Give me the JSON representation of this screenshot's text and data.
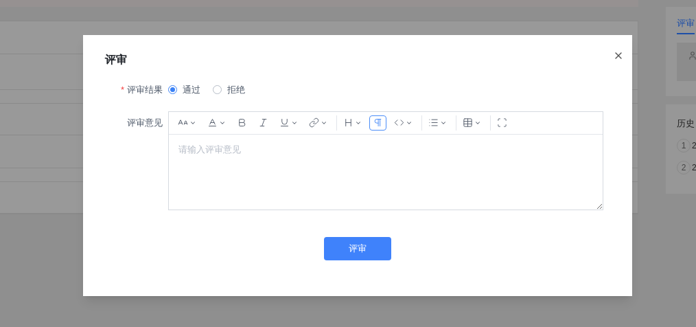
{
  "background": {
    "tabs": [
      {
        "label": "评审",
        "selected": true
      }
    ],
    "history": {
      "title": "历史",
      "steps": [
        {
          "index": "1",
          "text": "2"
        },
        {
          "index": "2",
          "text": "2"
        }
      ]
    }
  },
  "dialog": {
    "title": "评审",
    "fields": [
      {
        "kind": "radio",
        "label": "评审结果",
        "required_mark": "*",
        "options": [
          {
            "label": "通过",
            "selected": true
          },
          {
            "label": "拒绝",
            "selected": false
          }
        ]
      },
      {
        "kind": "editor",
        "label": "评审意见",
        "placeholder": "请输入评审意见",
        "toolbar": [
          [
            {
              "kind": "fontsize",
              "dropdown": true,
              "active": false
            },
            {
              "kind": "fontcolor",
              "dropdown": true,
              "active": false
            },
            {
              "kind": "bold",
              "dropdown": false,
              "active": false
            },
            {
              "kind": "italic",
              "dropdown": false,
              "active": false
            },
            {
              "kind": "underline",
              "dropdown": true,
              "active": false
            },
            {
              "kind": "link",
              "dropdown": true,
              "active": false
            }
          ],
          [
            {
              "kind": "heading",
              "dropdown": true,
              "active": false
            },
            {
              "kind": "paragraph",
              "dropdown": false,
              "active": true
            },
            {
              "kind": "code",
              "dropdown": true,
              "active": false
            }
          ],
          [
            {
              "kind": "list",
              "dropdown": true,
              "active": false
            }
          ],
          [
            {
              "kind": "table",
              "dropdown": true,
              "active": false
            }
          ],
          [
            {
              "kind": "fullscreen",
              "dropdown": false,
              "active": false
            }
          ]
        ]
      }
    ],
    "submit": "评审"
  }
}
